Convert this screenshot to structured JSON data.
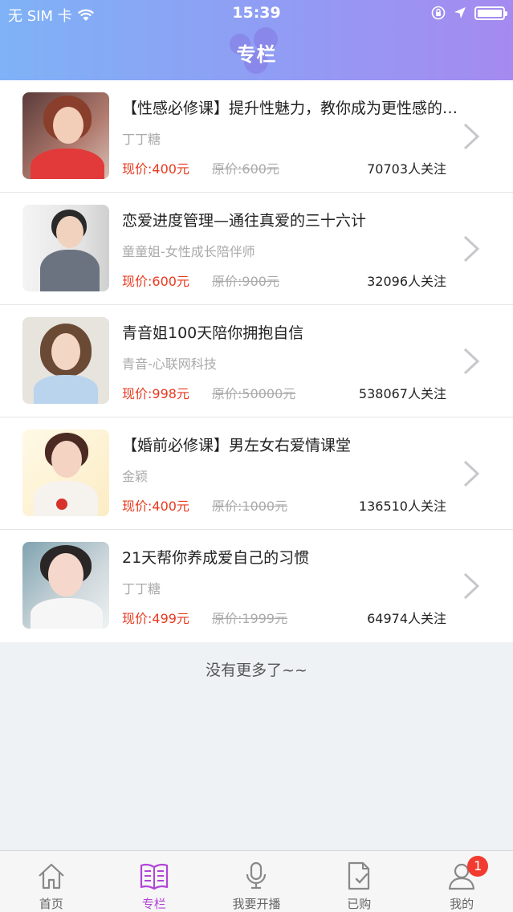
{
  "status_bar": {
    "carrier": "无 SIM 卡",
    "time": "15:39"
  },
  "header": {
    "title": "专栏"
  },
  "courses": [
    {
      "title": "【性感必修课】提升性魅力，教你成为更性感的女人",
      "author": "丁丁糖",
      "price": "现价:400元",
      "original_price": "原价:600元",
      "followers": "70703人关注"
    },
    {
      "title": "恋爱进度管理—通往真爱的三十六计",
      "author": "童童姐-女性成长陪伴师",
      "price": "现价:600元",
      "original_price": "原价:900元",
      "followers": "32096人关注"
    },
    {
      "title": "青音姐100天陪你拥抱自信",
      "author": "青音-心联网科技",
      "price": "现价:998元",
      "original_price": "原价:50000元",
      "followers": "538067人关注"
    },
    {
      "title": "【婚前必修课】男左女右爱情课堂",
      "author": "金颖",
      "price": "现价:400元",
      "original_price": "原价:1000元",
      "followers": "136510人关注"
    },
    {
      "title": "21天帮你养成爱自己的习惯",
      "author": "丁丁糖",
      "price": "现价:499元",
      "original_price": "原价:1999元",
      "followers": "64974人关注"
    }
  ],
  "list_footer": "没有更多了~~",
  "tabbar": {
    "tabs": [
      {
        "label": "首页",
        "icon": "home-icon",
        "active": false
      },
      {
        "label": "专栏",
        "icon": "book-icon",
        "active": true
      },
      {
        "label": "我要开播",
        "icon": "microphone-icon",
        "active": false
      },
      {
        "label": "已购",
        "icon": "purchased-doc-icon",
        "active": false
      },
      {
        "label": "我的",
        "icon": "user-icon",
        "active": false
      }
    ],
    "badge": "1"
  },
  "colors": {
    "accent": "#b244d8",
    "price": "#e8391f",
    "header_gradient_start": "#7fb2f6",
    "header_gradient_end": "#a58af0",
    "badge": "#f23b30"
  }
}
